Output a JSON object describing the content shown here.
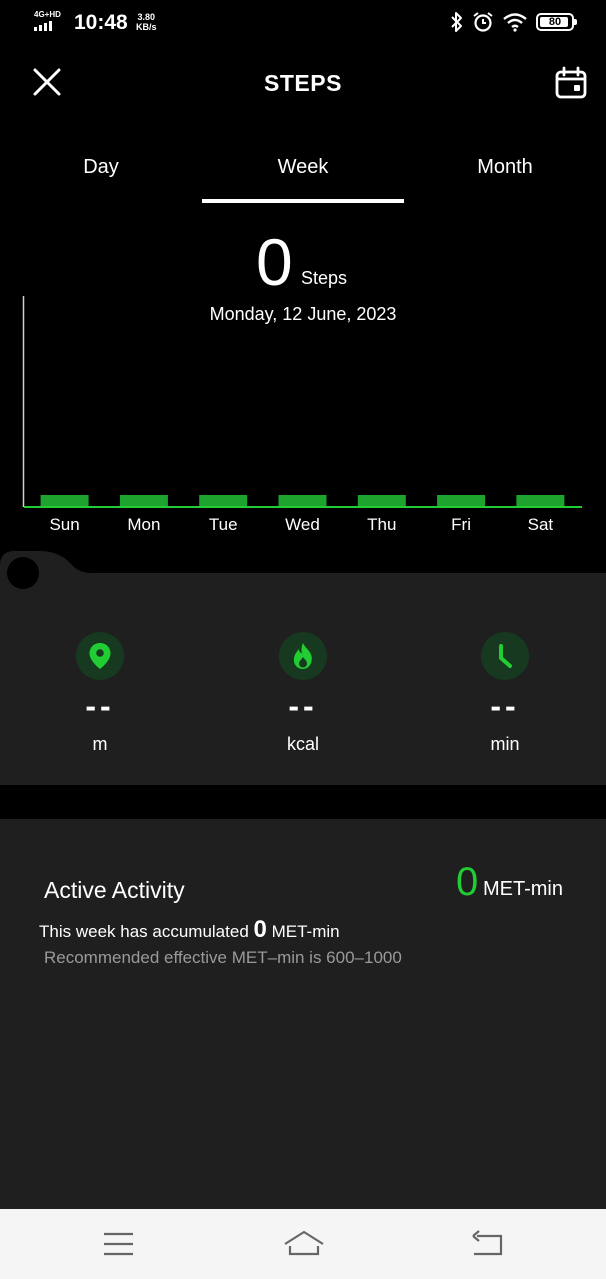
{
  "status_bar": {
    "network": "4G+HD",
    "time": "10:48",
    "speed_value": "3.80",
    "speed_unit": "KB/s",
    "battery": "80",
    "icons": [
      "bluetooth-icon",
      "alarm-icon",
      "wifi-icon",
      "battery-icon"
    ]
  },
  "header": {
    "title": "STEPS",
    "close_icon": "close-icon",
    "calendar_icon": "calendar-icon"
  },
  "tabs": [
    {
      "label": "Day",
      "active": false
    },
    {
      "label": "Week",
      "active": true
    },
    {
      "label": "Month",
      "active": false
    }
  ],
  "summary": {
    "steps_value": "0",
    "steps_unit": "Steps",
    "date": "Monday, 12 June, 2023"
  },
  "chart_data": {
    "type": "bar",
    "categories": [
      "Sun",
      "Mon",
      "Tue",
      "Wed",
      "Thu",
      "Fri",
      "Sat"
    ],
    "values": [
      0,
      0,
      0,
      0,
      0,
      0,
      0
    ],
    "bar_color": "#1ea32f",
    "axis_color": "#22cc33"
  },
  "stats": [
    {
      "icon": "location-pin-icon",
      "value": "--",
      "unit": "m"
    },
    {
      "icon": "flame-icon",
      "value": "--",
      "unit": "kcal"
    },
    {
      "icon": "clock-icon",
      "value": "--",
      "unit": "min"
    }
  ],
  "activity": {
    "title": "Active Activity",
    "value": "0",
    "value_unit": "MET-min",
    "summary_prefix": "This week has accumulated",
    "summary_value": "0",
    "summary_unit": "MET-min",
    "note": "Recommended effective MET–min is 600–1000"
  },
  "nav": {
    "icons": [
      "menu-icon",
      "home-icon",
      "back-icon"
    ]
  },
  "colors": {
    "accent": "#22cc33",
    "card": "#1f1f1f",
    "icon_bg": "#17391f"
  }
}
